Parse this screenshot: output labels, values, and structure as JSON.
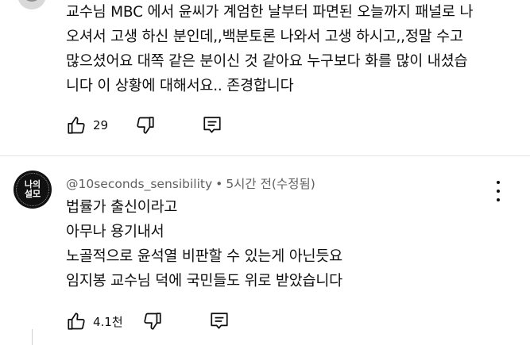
{
  "comment1": {
    "text": "교수님 MBC 에서 윤씨가 계엄한 날부터 파면된 오늘까지 패널로 나\n오셔서 고생 하신 분인데,,백분토론 나와서 고생 하시고,,정말 수고\n많으셨어요 대쪽 같은 분이신 것 같아요 누구보다 화를 많이 내셨습\n니다 이 상황에 대해서요.. 존경합니다",
    "like_count": "29"
  },
  "comment2": {
    "avatar_text": "나의\n설모",
    "handle": "@10seconds_sensibility",
    "separator": "•",
    "timestamp": "5시간 전(수정됨)",
    "text": "법률가 출신이라고\n아무나 용기내서\n노골적으로 윤석열 비판할 수 있는게 아닌듯요\n임지봉 교수님 덕에 국민들도 위로 받았습니다",
    "like_count": "4.1천"
  },
  "icons": {
    "like": "thumbs-up-icon",
    "dislike": "thumbs-down-icon",
    "reply": "reply-icon",
    "more": "more-vertical-icon"
  }
}
